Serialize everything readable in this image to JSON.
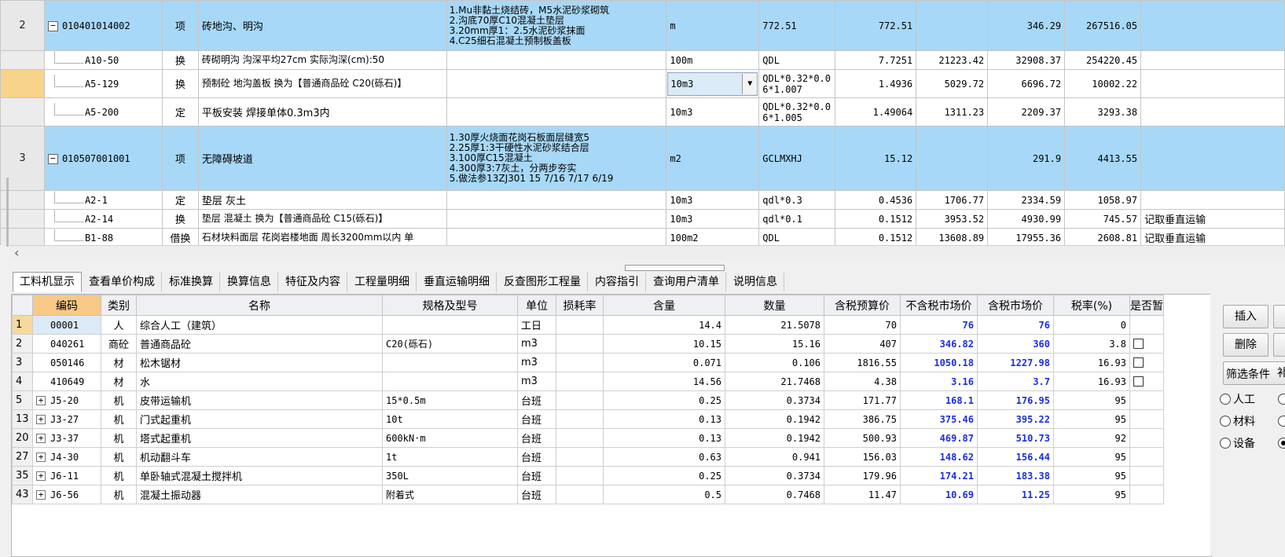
{
  "top_rows": [
    {
      "rownum": "2",
      "kind": "main",
      "code": "010401014002",
      "type": "项",
      "name": "砖地沟、明沟",
      "features": [
        "1.Mu非黏土烧结砖，M5水泥砂浆砌筑",
        "2.沟底70厚C10混凝土垫层",
        "3.20mm厚1：2.5水泥砂浆抹面",
        "4.C25细石混凝土预制板盖板"
      ],
      "unit": "m",
      "expr": "772.51",
      "qty": "772.51",
      "unit_price": "",
      "price1": "346.29",
      "total": "267516.05",
      "note": ""
    },
    {
      "rownum": "",
      "kind": "sub",
      "code": "A10-50",
      "type": "换",
      "name": "砖砌明沟 沟深平均27cm    实际沟深(cm):50",
      "features": [],
      "unit": "100m",
      "expr": "QDL",
      "qty": "7.7251",
      "unit_price": "21223.42",
      "price1": "32908.37",
      "total": "254220.45",
      "note": ""
    },
    {
      "rownum": "",
      "kind": "sub",
      "selected": true,
      "code": "A5-129",
      "type": "换",
      "name": "预制砼 地沟盖板  换为【普通商品砼 C20(砾石)】",
      "features": [],
      "unit": "10m3",
      "expr": "QDL*0.32*0.06*1.007",
      "qty": "1.4936",
      "unit_price": "5029.72",
      "price1": "6696.72",
      "total": "10002.22",
      "note": ""
    },
    {
      "rownum": "",
      "kind": "sub",
      "code": "A5-200",
      "type": "定",
      "name": "平板安装 焊接单体0.3m3内",
      "features": [],
      "unit": "10m3",
      "expr": "QDL*0.32*0.06*1.005",
      "qty": "1.49064",
      "unit_price": "1311.23",
      "price1": "2209.37",
      "total": "3293.38",
      "note": ""
    },
    {
      "rownum": "3",
      "kind": "main",
      "code": "010507001001",
      "type": "项",
      "name": "无障碍坡道",
      "features": [
        "1.30厚火烧面花岗石板面层缝宽5",
        "2.25厚1:3干硬性水泥砂浆结合层",
        "3.100厚C15混凝土",
        "4.300厚3:7灰土，分两步夯实",
        "5.做法参13ZJ301 15 7/16 7/17 6/19"
      ],
      "unit": "m2",
      "expr": "GCLMXHJ",
      "qty": "15.12",
      "unit_price": "",
      "price1": "291.9",
      "total": "4413.55",
      "note": ""
    },
    {
      "rownum": "",
      "kind": "sub",
      "code": "A2-1",
      "type": "定",
      "name": "垫层 灰土",
      "features": [],
      "unit": "10m3",
      "expr": "qdl*0.3",
      "qty": "0.4536",
      "unit_price": "1706.77",
      "price1": "2334.59",
      "total": "1058.97",
      "note": ""
    },
    {
      "rownum": "",
      "kind": "sub",
      "code": "A2-14",
      "type": "换",
      "name": "垫层 混凝土  换为【普通商品砼 C15(砾石)】",
      "features": [],
      "unit": "10m3",
      "expr": "qdl*0.1",
      "qty": "0.1512",
      "unit_price": "3953.52",
      "price1": "4930.99",
      "total": "745.57",
      "note": "记取垂直运输"
    },
    {
      "rownum": "",
      "kind": "sub",
      "code": "B1-88",
      "type": "借换",
      "name": "石材块料面层 花岗岩楼地面 周长3200mm以内 单",
      "features": [],
      "unit": "100m2",
      "expr": "QDL",
      "qty": "0.1512",
      "unit_price": "13608.89",
      "price1": "17955.36",
      "total": "2608.81",
      "note": "记取垂直运输"
    }
  ],
  "tabs": [
    "工料机显示",
    "查看单价构成",
    "标准换算",
    "换算信息",
    "特征及内容",
    "工程量明细",
    "垂直运输明细",
    "反查图形工程量",
    "内容指引",
    "查询用户清单",
    "说明信息"
  ],
  "active_tab": "工料机显示",
  "bottom_headers": [
    "编码",
    "类别",
    "名称",
    "规格及型号",
    "单位",
    "损耗率",
    "含量",
    "数量",
    "含税预算价",
    "不含税市场价",
    "含税市场价",
    "税率(%)",
    "是否暂"
  ],
  "bottom_rows": [
    {
      "idx": "1",
      "expand": false,
      "code": "00001",
      "cat": "人",
      "name": "综合人工（建筑）",
      "spec": "",
      "unit": "工日",
      "loss": "",
      "content": "14.4",
      "qty": "21.5078",
      "budget": "70",
      "mkt_ex": "76",
      "mkt_in": "76",
      "tax": "0",
      "chk": false
    },
    {
      "idx": "2",
      "expand": false,
      "code": "040261",
      "cat": "商砼",
      "name": "普通商品砼",
      "spec": "C20(砾石)",
      "unit": "m3",
      "loss": "",
      "content": "10.15",
      "qty": "15.16",
      "budget": "407",
      "mkt_ex": "346.82",
      "mkt_in": "360",
      "tax": "3.8",
      "chk": true
    },
    {
      "idx": "3",
      "expand": false,
      "code": "050146",
      "cat": "材",
      "name": "松木锯材",
      "spec": "",
      "unit": "m3",
      "loss": "",
      "content": "0.071",
      "qty": "0.106",
      "budget": "1816.55",
      "mkt_ex": "1050.18",
      "mkt_in": "1227.98",
      "tax": "16.93",
      "chk": true
    },
    {
      "idx": "4",
      "expand": false,
      "code": "410649",
      "cat": "材",
      "name": "水",
      "spec": "",
      "unit": "m3",
      "loss": "",
      "content": "14.56",
      "qty": "21.7468",
      "budget": "4.38",
      "mkt_ex": "3.16",
      "mkt_in": "3.7",
      "tax": "16.93",
      "chk": true
    },
    {
      "idx": "5",
      "expand": true,
      "code": "J5-20",
      "cat": "机",
      "name": "皮带运输机",
      "spec": "15*0.5m",
      "unit": "台班",
      "loss": "",
      "content": "0.25",
      "qty": "0.3734",
      "budget": "171.77",
      "mkt_ex": "168.1",
      "mkt_in": "176.95",
      "tax": "95",
      "chk": false
    },
    {
      "idx": "13",
      "expand": true,
      "code": "J3-27",
      "cat": "机",
      "name": "门式起重机",
      "spec": "10t",
      "unit": "台班",
      "loss": "",
      "content": "0.13",
      "qty": "0.1942",
      "budget": "386.75",
      "mkt_ex": "375.46",
      "mkt_in": "395.22",
      "tax": "95",
      "chk": false
    },
    {
      "idx": "20",
      "expand": true,
      "code": "J3-37",
      "cat": "机",
      "name": "塔式起重机",
      "spec": "600kN·m",
      "unit": "台班",
      "loss": "",
      "content": "0.13",
      "qty": "0.1942",
      "budget": "500.93",
      "mkt_ex": "469.87",
      "mkt_in": "510.73",
      "tax": "92",
      "chk": false
    },
    {
      "idx": "27",
      "expand": true,
      "code": "J4-30",
      "cat": "机",
      "name": "机动翻斗车",
      "spec": "1t",
      "unit": "台班",
      "loss": "",
      "content": "0.63",
      "qty": "0.941",
      "budget": "156.03",
      "mkt_ex": "148.62",
      "mkt_in": "156.44",
      "tax": "95",
      "chk": false
    },
    {
      "idx": "35",
      "expand": true,
      "code": "J6-11",
      "cat": "机",
      "name": "单卧轴式混凝土搅拌机",
      "spec": "350L",
      "unit": "台班",
      "loss": "",
      "content": "0.25",
      "qty": "0.3734",
      "budget": "179.96",
      "mkt_ex": "174.21",
      "mkt_in": "183.38",
      "tax": "95",
      "chk": false
    },
    {
      "idx": "43",
      "expand": true,
      "code": "J6-56",
      "cat": "机",
      "name": "混凝土振动器",
      "spec": "附着式",
      "unit": "台班",
      "loss": "",
      "content": "0.5",
      "qty": "0.7468",
      "budget": "11.47",
      "mkt_ex": "10.69",
      "mkt_in": "11.25",
      "tax": "95",
      "chk": false
    }
  ],
  "right_panel": {
    "insert_label": "插入",
    "delete_label": "删除",
    "supplement_label": "补充",
    "filter_label": "筛选条件",
    "radios": [
      {
        "label": "人工",
        "checked": false
      },
      {
        "label": "材料",
        "checked": false
      },
      {
        "label": "设备",
        "checked": false
      }
    ],
    "radios_right": [
      false,
      false,
      true
    ]
  },
  "colors": {
    "main_row": "#a7d8f7",
    "blue_price": "#1a2fe0",
    "selected_rownum": "#f8d38a",
    "code_header": "#f8c987"
  },
  "icons": {
    "collapse": "minus-box-icon",
    "expand": "plus-box-icon",
    "dropdown": "chevron-down-icon",
    "scroll_left": "arrow-left-icon"
  }
}
